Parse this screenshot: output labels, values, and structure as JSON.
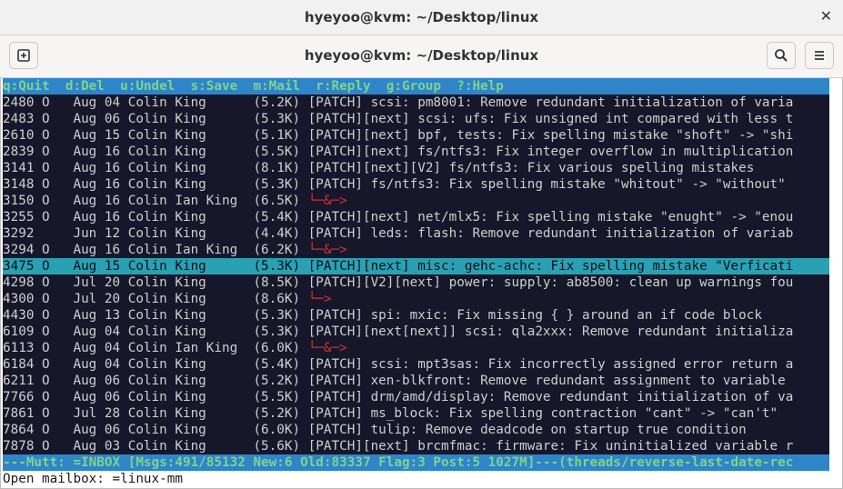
{
  "window": {
    "title": "hyeyoo@kvm: ~/Desktop/linux",
    "close_glyph": "✕"
  },
  "headerbar": {
    "title": "hyeyoo@kvm: ~/Desktop/linux",
    "new_tab_icon": "new-tab-icon",
    "search_icon": "search-icon",
    "menu_icon": "hamburger-menu-icon"
  },
  "help_line": "q:Quit  d:Del  u:Undel  s:Save  m:Mail  r:Reply  g:Group  ?:Help",
  "rows": [
    {
      "num": "2480",
      "flag": "O",
      "date": "Aug 04",
      "from": "Colin King",
      "size": "(5.2K)",
      "subject": "[PATCH] scsi: pm8001: Remove redundant initialization of varia",
      "tree": false
    },
    {
      "num": "2483",
      "flag": "O",
      "date": "Aug 06",
      "from": "Colin King",
      "size": "(5.3K)",
      "subject": "[PATCH][next] scsi: ufs: Fix unsigned int compared with less t",
      "tree": false
    },
    {
      "num": "2610",
      "flag": "O",
      "date": "Aug 15",
      "from": "Colin King",
      "size": "(5.1K)",
      "subject": "[PATCH][next] bpf, tests: Fix spelling mistake \"shoft\" -> \"shi",
      "tree": false
    },
    {
      "num": "2839",
      "flag": "O",
      "date": "Aug 16",
      "from": "Colin King",
      "size": "(5.5K)",
      "subject": "[PATCH][next] fs/ntfs3: Fix integer overflow in multiplication",
      "tree": false
    },
    {
      "num": "3141",
      "flag": "O",
      "date": "Aug 16",
      "from": "Colin King",
      "size": "(8.1K)",
      "subject": "[PATCH][next][V2] fs/ntfs3: Fix various spelling mistakes",
      "tree": false
    },
    {
      "num": "3148",
      "flag": "O",
      "date": "Aug 16",
      "from": "Colin King",
      "size": "(5.3K)",
      "subject": "[PATCH] fs/ntfs3: Fix spelling mistake \"whitout\" -> \"without\"",
      "tree": false
    },
    {
      "num": "3150",
      "flag": "O",
      "date": "Aug 16",
      "from": "Colin Ian King",
      "size": "(6.5K)",
      "subject": "└─&─>",
      "tree": true
    },
    {
      "num": "3255",
      "flag": "O",
      "date": "Aug 16",
      "from": "Colin King",
      "size": "(5.4K)",
      "subject": "[PATCH][next] net/mlx5: Fix spelling mistake \"enught\" -> \"enou",
      "tree": false
    },
    {
      "num": "3292",
      "flag": " ",
      "date": "Jun 12",
      "from": "Colin King",
      "size": "(4.4K)",
      "subject": "[PATCH] leds: flash: Remove redundant initialization of variab",
      "tree": false
    },
    {
      "num": "3294",
      "flag": "O",
      "date": "Aug 16",
      "from": "Colin Ian King",
      "size": "(6.2K)",
      "subject": "└─&─>",
      "tree": true
    },
    {
      "num": "3475",
      "flag": "O",
      "date": "Aug 15",
      "from": "Colin King",
      "size": "(5.3K)",
      "subject": "[PATCH][next] misc: gehc-achc: Fix spelling mistake \"Verficati",
      "tree": false,
      "selected": true
    },
    {
      "num": "4298",
      "flag": "O",
      "date": "Jul 20",
      "from": "Colin King",
      "size": "(8.5K)",
      "subject": "[PATCH][V2][next] power: supply: ab8500: clean up warnings fou",
      "tree": false
    },
    {
      "num": "4300",
      "flag": "O",
      "date": "Jul 20",
      "from": "Colin King",
      "size": "(8.6K)",
      "subject": "└─>",
      "tree": true
    },
    {
      "num": "4430",
      "flag": "O",
      "date": "Aug 13",
      "from": "Colin King",
      "size": "(5.3K)",
      "subject": "[PATCH] spi: mxic: Fix missing { } around an if code block",
      "tree": false
    },
    {
      "num": "6109",
      "flag": "O",
      "date": "Aug 04",
      "from": "Colin King",
      "size": "(5.3K)",
      "subject": "[PATCH][next[next]] scsi: qla2xxx: Remove redundant initializa",
      "tree": false
    },
    {
      "num": "6113",
      "flag": "O",
      "date": "Aug 04",
      "from": "Colin Ian King",
      "size": "(6.0K)",
      "subject": "└─&─>",
      "tree": true
    },
    {
      "num": "6184",
      "flag": "O",
      "date": "Aug 04",
      "from": "Colin King",
      "size": "(5.4K)",
      "subject": "[PATCH] scsi: mpt3sas: Fix incorrectly assigned error return a",
      "tree": false
    },
    {
      "num": "6211",
      "flag": "O",
      "date": "Aug 06",
      "from": "Colin King",
      "size": "(5.2K)",
      "subject": "[PATCH] xen-blkfront: Remove redundant assignment to variable ",
      "tree": false
    },
    {
      "num": "7766",
      "flag": "O",
      "date": "Aug 06",
      "from": "Colin King",
      "size": "(5.5K)",
      "subject": "[PATCH] drm/amd/display: Remove redundant initialization of va",
      "tree": false
    },
    {
      "num": "7861",
      "flag": "O",
      "date": "Jul 28",
      "from": "Colin King",
      "size": "(5.2K)",
      "subject": "[PATCH] ms_block: Fix spelling contraction \"cant\" -> \"can't\"",
      "tree": false
    },
    {
      "num": "7864",
      "flag": "O",
      "date": "Aug 06",
      "from": "Colin King",
      "size": "(6.0K)",
      "subject": "[PATCH] tulip: Remove deadcode on startup true condition",
      "tree": false
    },
    {
      "num": "7878",
      "flag": "O",
      "date": "Aug 03",
      "from": "Colin King",
      "size": "(5.6K)",
      "subject": "[PATCH][next] brcmfmac: firmware: Fix uninitialized variable r",
      "tree": false
    }
  ],
  "status_line": "---Mutt: =INBOX [Msgs:491/85132 New:6 Old:83337 Flag:3 Post:5 1027M]---(threads/reverse-last-date-rec",
  "command_line": "Open mailbox: =linux-mm",
  "colors": {
    "help_bg": "#2e85c8",
    "help_fg": "#7fd38c",
    "index_bg": "#16172a",
    "selected_bg": "#2aa1b3",
    "tree_fg": "#d2362f"
  }
}
